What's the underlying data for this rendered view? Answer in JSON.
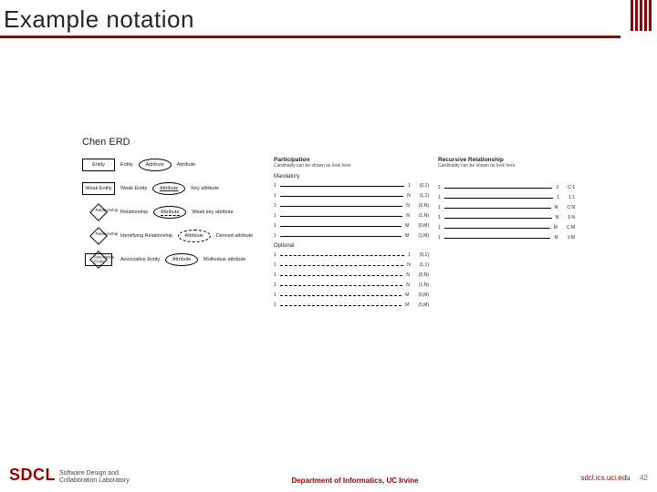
{
  "title": "Example notation",
  "content": {
    "heading": "Chen ERD",
    "shapes": [
      {
        "name": "Entity",
        "label": "Entity",
        "cls": "rect"
      },
      {
        "name": "Weak Entity",
        "label": "Weak Entity",
        "cls": "rect-d"
      },
      {
        "name": "Relationship",
        "label": "Relationship",
        "cls": "diamond"
      },
      {
        "name": "Identifying Relationship",
        "label": "Relationship",
        "cls": "diamond-d"
      },
      {
        "name": "Associative Entity",
        "label": "Associative Entity",
        "cls": "diamond-assoc"
      }
    ],
    "attrs": [
      {
        "name": "Attribute",
        "label": "Attribute",
        "cls": "oval"
      },
      {
        "name": "Key attribute",
        "label": "Attribute",
        "cls": "oval",
        "txtcls": "ul"
      },
      {
        "name": "Weak key attribute",
        "label": "Attribute",
        "cls": "oval",
        "txtcls": "dul"
      },
      {
        "name": "Derived attribute",
        "label": "Attribute",
        "cls": "oval-dash"
      },
      {
        "name": "Multivalue attribute",
        "label": "Attribute",
        "cls": "oval-d"
      }
    ],
    "participation": {
      "title": "Participation",
      "subtitle": "Cardinality can be shown as look here",
      "mandatory": "Mandatory",
      "optional": "Optional",
      "rows_m": [
        {
          "left": "1",
          "right": "1",
          "tag": "(0,1)"
        },
        {
          "left": "1",
          "right": "N",
          "tag": "(1,1)"
        },
        {
          "left": "1",
          "right": "N",
          "tag": "(0,N)"
        },
        {
          "left": "1",
          "right": "N",
          "tag": "(1,N)"
        },
        {
          "left": "1",
          "right": "M",
          "tag": "(0,M)"
        },
        {
          "left": "1",
          "right": "M",
          "tag": "(1,M)"
        }
      ],
      "rows_o": [
        {
          "left": "1",
          "right": "1",
          "tag": "(0,1)"
        },
        {
          "left": "1",
          "right": "N",
          "tag": "(1,1)"
        },
        {
          "left": "1",
          "right": "N",
          "tag": "(0,N)"
        },
        {
          "left": "1",
          "right": "N",
          "tag": "(1,N)"
        },
        {
          "left": "1",
          "right": "M",
          "tag": "(0,M)"
        },
        {
          "left": "1",
          "right": "M",
          "tag": "(1,M)"
        }
      ]
    },
    "recursive": {
      "title": "Recursive Relationship",
      "subtitle": "Cardinality can be shown as look here",
      "rows": [
        {
          "left": "1",
          "right": "1",
          "tag": "C:1"
        },
        {
          "left": "1",
          "right": "1",
          "tag": "1:1"
        },
        {
          "left": "1",
          "right": "N",
          "tag": "C:N"
        },
        {
          "left": "1",
          "right": "N",
          "tag": "1:N"
        },
        {
          "left": "1",
          "right": "M",
          "tag": "C:M"
        },
        {
          "left": "1",
          "right": "M",
          "tag": "1:M"
        }
      ]
    }
  },
  "footer": {
    "sdcl": "SDCL",
    "sub1": "Software Design and",
    "sub2": "Collaboration Laboratory",
    "dept": "Department of Informatics, UC Irvine",
    "url": "sdcl.ics.uci.edu",
    "page": "42"
  }
}
